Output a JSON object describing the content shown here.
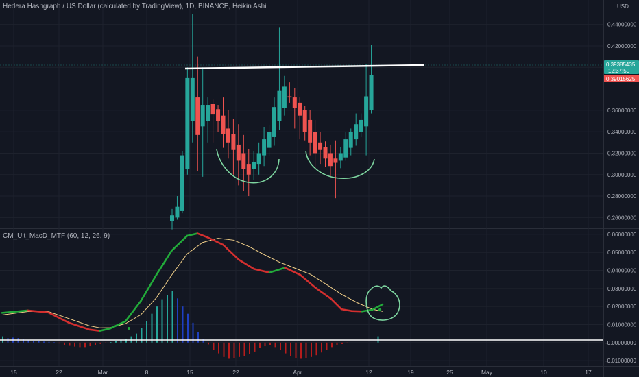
{
  "header": {
    "title": "Hedera Hashgraph / US Dollar (calculated by TradingView), 1D, BINANCE, Heikin Ashi",
    "currency": "USD"
  },
  "indicator": {
    "title": "CM_Ult_MacD_MTF (60, 12, 26, 9)"
  },
  "price_axis": {
    "ticks": [
      "0.44000000",
      "0.42000000",
      "0.40000000",
      "0.36000000",
      "0.34000000",
      "0.32000000",
      "0.30000000",
      "0.28000000",
      "0.26000000"
    ],
    "tick_values": [
      0.44,
      0.42,
      0.4,
      0.36,
      0.34,
      0.32,
      0.3,
      0.28,
      0.26
    ],
    "last_price": "0.39385435",
    "countdown": "12:37:50",
    "prev_price": "0.39015625",
    "last_price_value": 0.39385435,
    "prev_price_value": 0.39015625
  },
  "macd_axis": {
    "ticks": [
      "0.06000000",
      "0.05000000",
      "0.04000000",
      "0.03000000",
      "0.02000000",
      "0.01000000",
      "-0.00000000",
      "-0.01000000"
    ],
    "tick_values": [
      0.06,
      0.05,
      0.04,
      0.03,
      0.02,
      0.01,
      0.0,
      -0.01
    ]
  },
  "time_axis": {
    "labels": [
      "15",
      "22",
      "Mar",
      "8",
      "15",
      "22",
      "Apr",
      "12",
      "19",
      "25",
      "May",
      "10",
      "17"
    ]
  },
  "colors": {
    "up": "#26a69a",
    "down": "#ef5350",
    "macd_up": "#22ab3a",
    "macd_down": "#d32f2f",
    "signal": "#f5d28a",
    "hist_teal": "#26a69a",
    "hist_blue": "#1e3fc1",
    "hist_red": "#b71c1c",
    "annotation": "#7ed6a0",
    "resistance": "#ffffff",
    "price_tag": "#26a69a",
    "prev_tag": "#ef5350"
  },
  "chart_data": [
    {
      "type": "candlestick",
      "title": "Hedera Hashgraph / US Dollar (calculated by TradingView), 1D, BINANCE, Heikin Ashi",
      "ylim": [
        0.25,
        0.45
      ],
      "candles": [
        {
          "o": 0.257,
          "c": 0.262,
          "h": 0.268,
          "l": 0.249
        },
        {
          "o": 0.26,
          "c": 0.27,
          "h": 0.28,
          "l": 0.258
        },
        {
          "o": 0.266,
          "c": 0.318,
          "h": 0.322,
          "l": 0.264
        },
        {
          "o": 0.305,
          "c": 0.39,
          "h": 0.4,
          "l": 0.3
        },
        {
          "o": 0.35,
          "c": 0.39,
          "h": 0.45,
          "l": 0.33
        },
        {
          "o": 0.372,
          "c": 0.337,
          "h": 0.41,
          "l": 0.303
        },
        {
          "o": 0.345,
          "c": 0.365,
          "h": 0.4,
          "l": 0.298
        },
        {
          "o": 0.35,
          "c": 0.365,
          "h": 0.372,
          "l": 0.33
        },
        {
          "o": 0.366,
          "c": 0.356,
          "h": 0.37,
          "l": 0.33
        },
        {
          "o": 0.361,
          "c": 0.35,
          "h": 0.365,
          "l": 0.34
        },
        {
          "o": 0.355,
          "c": 0.338,
          "h": 0.372,
          "l": 0.325
        },
        {
          "o": 0.343,
          "c": 0.33,
          "h": 0.36,
          "l": 0.315
        },
        {
          "o": 0.338,
          "c": 0.323,
          "h": 0.352,
          "l": 0.3
        },
        {
          "o": 0.328,
          "c": 0.313,
          "h": 0.347,
          "l": 0.29
        },
        {
          "o": 0.32,
          "c": 0.305,
          "h": 0.337,
          "l": 0.285
        },
        {
          "o": 0.31,
          "c": 0.3,
          "h": 0.324,
          "l": 0.28
        },
        {
          "o": 0.305,
          "c": 0.312,
          "h": 0.322,
          "l": 0.295
        },
        {
          "o": 0.31,
          "c": 0.32,
          "h": 0.33,
          "l": 0.3
        },
        {
          "o": 0.318,
          "c": 0.333,
          "h": 0.344,
          "l": 0.308
        },
        {
          "o": 0.325,
          "c": 0.34,
          "h": 0.346,
          "l": 0.317
        },
        {
          "o": 0.335,
          "c": 0.363,
          "h": 0.372,
          "l": 0.327
        },
        {
          "o": 0.35,
          "c": 0.378,
          "h": 0.437,
          "l": 0.342
        },
        {
          "o": 0.362,
          "c": 0.382,
          "h": 0.392,
          "l": 0.355
        },
        {
          "o": 0.373,
          "c": 0.372,
          "h": 0.386,
          "l": 0.367
        },
        {
          "o": 0.372,
          "c": 0.362,
          "h": 0.381,
          "l": 0.343
        },
        {
          "o": 0.367,
          "c": 0.355,
          "h": 0.372,
          "l": 0.333
        },
        {
          "o": 0.36,
          "c": 0.34,
          "h": 0.364,
          "l": 0.332
        },
        {
          "o": 0.351,
          "c": 0.33,
          "h": 0.36,
          "l": 0.318
        },
        {
          "o": 0.34,
          "c": 0.32,
          "h": 0.351,
          "l": 0.305
        },
        {
          "o": 0.33,
          "c": 0.323,
          "h": 0.34,
          "l": 0.31
        },
        {
          "o": 0.326,
          "c": 0.315,
          "h": 0.331,
          "l": 0.307
        },
        {
          "o": 0.32,
          "c": 0.308,
          "h": 0.328,
          "l": 0.298
        },
        {
          "o": 0.315,
          "c": 0.311,
          "h": 0.332,
          "l": 0.278
        },
        {
          "o": 0.313,
          "c": 0.32,
          "h": 0.326,
          "l": 0.306
        },
        {
          "o": 0.316,
          "c": 0.333,
          "h": 0.34,
          "l": 0.313
        },
        {
          "o": 0.325,
          "c": 0.34,
          "h": 0.343,
          "l": 0.318
        },
        {
          "o": 0.333,
          "c": 0.347,
          "h": 0.357,
          "l": 0.327
        },
        {
          "o": 0.34,
          "c": 0.351,
          "h": 0.357,
          "l": 0.335
        },
        {
          "o": 0.345,
          "c": 0.373,
          "h": 0.403,
          "l": 0.318
        },
        {
          "o": 0.36,
          "c": 0.393,
          "h": 0.421,
          "l": 0.357
        }
      ]
    },
    {
      "type": "line",
      "title": "CM_Ult_MacD_MTF (60, 12, 26, 9)",
      "ylim": [
        -0.013,
        0.063
      ],
      "x_span": 48,
      "series": [
        {
          "values": [
            [
              0,
              0.0165
            ],
            [
              5,
              0.0178
            ],
            [
              9,
              0.0167
            ],
            [
              13,
              0.011
            ],
            [
              17,
              0.0072
            ],
            [
              19,
              0.0065
            ],
            [
              21,
              0.0078
            ],
            [
              24,
              0.0118
            ],
            [
              27,
              0.0231
            ],
            [
              30,
              0.0375
            ],
            [
              33,
              0.051
            ],
            [
              36,
              0.0592
            ],
            [
              38,
              0.0605
            ],
            [
              40,
              0.0583
            ],
            [
              43,
              0.0542
            ],
            [
              46,
              0.046
            ],
            [
              49,
              0.0408
            ],
            [
              52,
              0.0388
            ],
            [
              55,
              0.0415
            ],
            [
              58,
              0.0375
            ],
            [
              61,
              0.0303
            ],
            [
              64,
              0.0242
            ],
            [
              66,
              0.0185
            ],
            [
              68,
              0.0175
            ],
            [
              70,
              0.0173
            ],
            [
              72,
              0.0182
            ],
            [
              74,
              0.0212
            ]
          ]
        },
        {
          "values": [
            [
              0,
              0.0153
            ],
            [
              5,
              0.0172
            ],
            [
              9,
              0.0172
            ],
            [
              13,
              0.0133
            ],
            [
              17,
              0.0093
            ],
            [
              19,
              0.0082
            ],
            [
              21,
              0.0083
            ],
            [
              24,
              0.0105
            ],
            [
              27,
              0.0155
            ],
            [
              30,
              0.0248
            ],
            [
              33,
              0.0375
            ],
            [
              36,
              0.0492
            ],
            [
              39,
              0.0555
            ],
            [
              42,
              0.0578
            ],
            [
              45,
              0.0568
            ],
            [
              48,
              0.0533
            ],
            [
              51,
              0.0487
            ],
            [
              54,
              0.0445
            ],
            [
              57,
              0.0412
            ],
            [
              60,
              0.0378
            ],
            [
              63,
              0.0324
            ],
            [
              66,
              0.0268
            ],
            [
              69,
              0.0222
            ],
            [
              72,
              0.0185
            ],
            [
              74,
              0.0173
            ]
          ]
        },
        {
          "values": [
            0.0035,
            0.0025,
            0.0028,
            0.0025,
            0.0018,
            0.0013,
            0.001,
            0.0009,
            0.0005,
            0.0004,
            0.0002,
            -0.0005,
            -0.0015,
            -0.0018,
            -0.0022,
            -0.0025,
            -0.0025,
            -0.002,
            -0.0015,
            -0.0008,
            -0.0003,
            0.0003,
            0.001,
            0.0015,
            0.0022,
            0.0035,
            0.005,
            0.008,
            0.012,
            0.016,
            0.02,
            0.024,
            0.0265,
            0.0285,
            0.0245,
            0.02,
            0.016,
            0.011,
            0.006,
            0.002,
            -0.001,
            -0.004,
            -0.006,
            -0.008,
            -0.009,
            -0.0085,
            -0.008,
            -0.0075,
            -0.0065,
            -0.005,
            -0.003,
            -0.002,
            -0.0015,
            -0.0025,
            -0.004,
            -0.006,
            -0.0075,
            -0.0085,
            -0.009,
            -0.0088,
            -0.008,
            -0.007,
            -0.0055,
            -0.004,
            -0.0025,
            -0.0015,
            -0.0008,
            -0.0002,
            0.0,
            0.0,
            0.0,
            0.0,
            0.0,
            0.0035
          ]
        }
      ]
    }
  ]
}
